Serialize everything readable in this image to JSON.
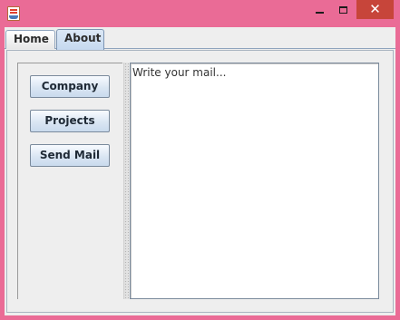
{
  "window": {
    "controls": {
      "minimize": "–",
      "maximize": "☐",
      "close": "✕"
    },
    "colors": {
      "titlebar": "#ea6b96",
      "close_button": "#c7453a"
    },
    "app_icon": "java-cup-icon"
  },
  "tabs": [
    {
      "label": "Home",
      "selected": false
    },
    {
      "label": "About",
      "selected": true
    }
  ],
  "about": {
    "buttons": {
      "company": "Company",
      "projects": "Projects",
      "send_mail": "Send Mail"
    },
    "mail_text": "Write your mail..."
  }
}
